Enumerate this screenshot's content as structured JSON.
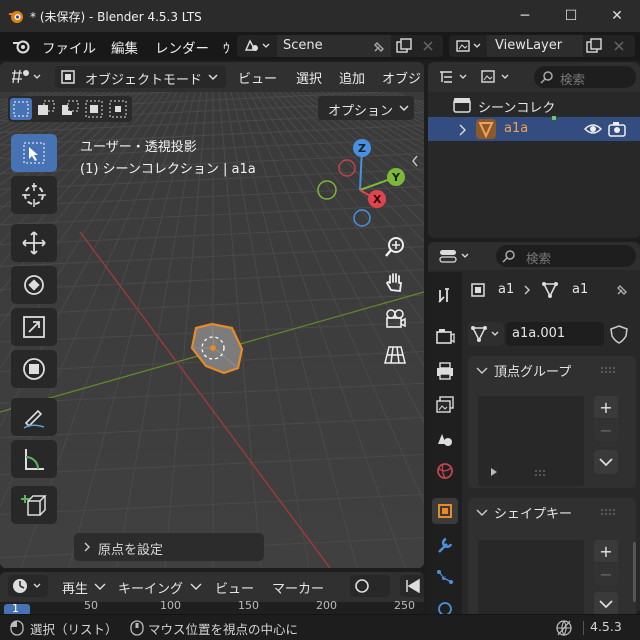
{
  "window": {
    "title": "* (未保存) - Blender 4.5.3 LTS",
    "min_glyph": "─",
    "max_glyph": "☐",
    "close_glyph": "✕"
  },
  "menubar": {
    "items": [
      "ファイル",
      "編集",
      "レンダー",
      "ｳ"
    ],
    "scene_name": "Scene",
    "view_layer": "ViewLayer"
  },
  "viewport": {
    "mode_label": "オブジェクトモード",
    "menus": [
      "ビュー",
      "選択",
      "追加",
      "オブジ"
    ],
    "options_label": "オプション",
    "overlay_title": "ユーザー・透視投影",
    "overlay_collection": "(1) シーンコレクション | a1a",
    "gizmo": {
      "z": "Z",
      "y": "Y",
      "x": "X"
    },
    "last_op_label": "原点を設定",
    "colors": {
      "x_axis": "#a33a3a",
      "y_axis": "#5f8a2a",
      "selected": "#e88a2a",
      "active_tool": "#4772b3"
    }
  },
  "outliner": {
    "search_placeholder": "検索",
    "root": "シーンコレク",
    "item": "a1a"
  },
  "properties": {
    "search_placeholder": "検索",
    "breadcrumb": [
      "a1",
      "a1"
    ],
    "mesh_name": "a1a.001",
    "panels": [
      {
        "title": "頂点グループ"
      },
      {
        "title": "シェイプキー"
      }
    ],
    "add_glyph": "+",
    "remove_glyph": "−"
  },
  "timeline": {
    "menus": [
      "再生",
      "キーイング",
      "ビュー",
      "マーカー"
    ],
    "current_frame": "1",
    "ticks": [
      "50",
      "100",
      "150",
      "200",
      "250"
    ]
  },
  "statusbar": {
    "left_hint": "選択（リスト）",
    "mid_hint": "マウス位置を視点の中心に",
    "version": "4.5.3"
  }
}
